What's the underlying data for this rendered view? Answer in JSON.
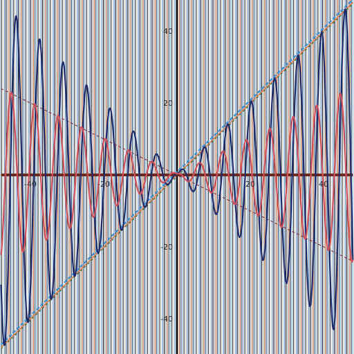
{
  "chart_data": {
    "type": "line",
    "title": "",
    "xlabel": "",
    "ylabel": "",
    "xlim": [
      -48,
      48
    ],
    "ylim": [
      -48,
      48
    ],
    "grid": true,
    "legend": "none",
    "colors": {
      "background": "#ffffff",
      "grid_cycle": [
        "#8fb8d8",
        "#3a3a3a",
        "#d8d8d8",
        "#5b8fc4",
        "#1a1a2e",
        "#a8a8a8",
        "#c26a3a",
        "#2d4f7a"
      ],
      "axes": "#000000",
      "horizontal_band": "#6b2a1f"
    },
    "x_ticks": [
      {
        "value": -40,
        "label": "-40"
      },
      {
        "value": -20,
        "label": "-20"
      },
      {
        "value": 20,
        "label": "20"
      },
      {
        "value": 40,
        "label": "40"
      }
    ],
    "y_ticks": [
      {
        "value": 40,
        "label": "40"
      },
      {
        "value": 20,
        "label": "20"
      },
      {
        "value": -20,
        "label": "-20"
      },
      {
        "value": -40,
        "label": "-40"
      }
    ],
    "series": [
      {
        "kind": "line",
        "slope": 1,
        "intercept": 0,
        "color": "#e07840",
        "width": 1.4
      },
      {
        "kind": "line",
        "slope": 1,
        "intercept": 0.8,
        "color": "#3b8fd0",
        "width": 2.4,
        "dash": "5,3"
      },
      {
        "kind": "line",
        "slope": 1,
        "intercept": -0.4,
        "color": "#1f6a3a",
        "width": 1.2,
        "dash": "3,4"
      },
      {
        "kind": "line",
        "slope": -0.5,
        "intercept": 0,
        "color": "#7a1f2a",
        "width": 1.0,
        "dash": "4,3"
      },
      {
        "kind": "line",
        "slope": 0,
        "intercept": 0,
        "color": "#6b2a1f",
        "width": 4.0
      },
      {
        "kind": "wave",
        "amp_slope": 1,
        "amp_offset": 0.3,
        "freq": 0.98,
        "phase": 0.6,
        "color": "#1f2c6b",
        "width": 2.2
      },
      {
        "kind": "wave",
        "amp_slope": 0.5,
        "amp_offset": 0.3,
        "freq": 0.98,
        "phase": 1.9,
        "color": "#d0505a",
        "width": 2.2
      }
    ]
  }
}
